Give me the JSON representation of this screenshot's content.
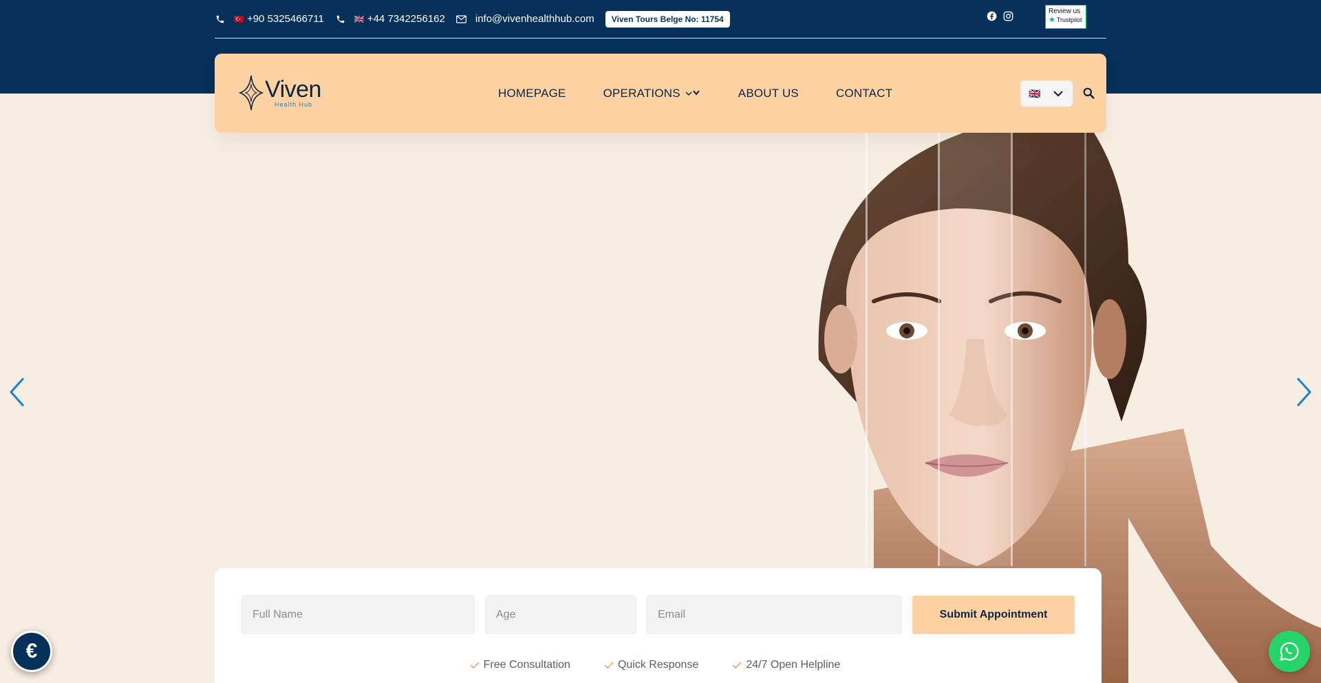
{
  "topbar": {
    "phone_1": {
      "flag": "🇹🇷",
      "number": "+90 5325466711"
    },
    "phone_2": {
      "flag": "🇬🇧",
      "number": "+44 7342256162"
    },
    "email": "info@vivenhealthhub.com",
    "license_badge": "Viven Tours Belge No: 11754",
    "trustpilot": {
      "title": "Review us",
      "brand": "Trustpilot"
    }
  },
  "header": {
    "logo": {
      "brand": "Viven",
      "sub": "Health Hub"
    },
    "nav": {
      "homepage": "HOMEPAGE",
      "operations": "OPERATIONS",
      "about": "ABOUT US",
      "contact": "CONTACT"
    },
    "language": {
      "selected": "🇬🇧"
    }
  },
  "form": {
    "name_placeholder": "Full Name",
    "age_placeholder": "Age",
    "email_placeholder": "Email",
    "submit_label": "Submit Appointment",
    "features": [
      "Free Consultation",
      "Quick Response",
      "24/7 Open Helpline"
    ]
  },
  "floating": {
    "currency_symbol": "€"
  },
  "colors": {
    "brand_navy": "#04305a",
    "accent_peach": "#ffd2a3",
    "hero_bg": "#f6ede3",
    "whatsapp_green": "#25d366"
  }
}
